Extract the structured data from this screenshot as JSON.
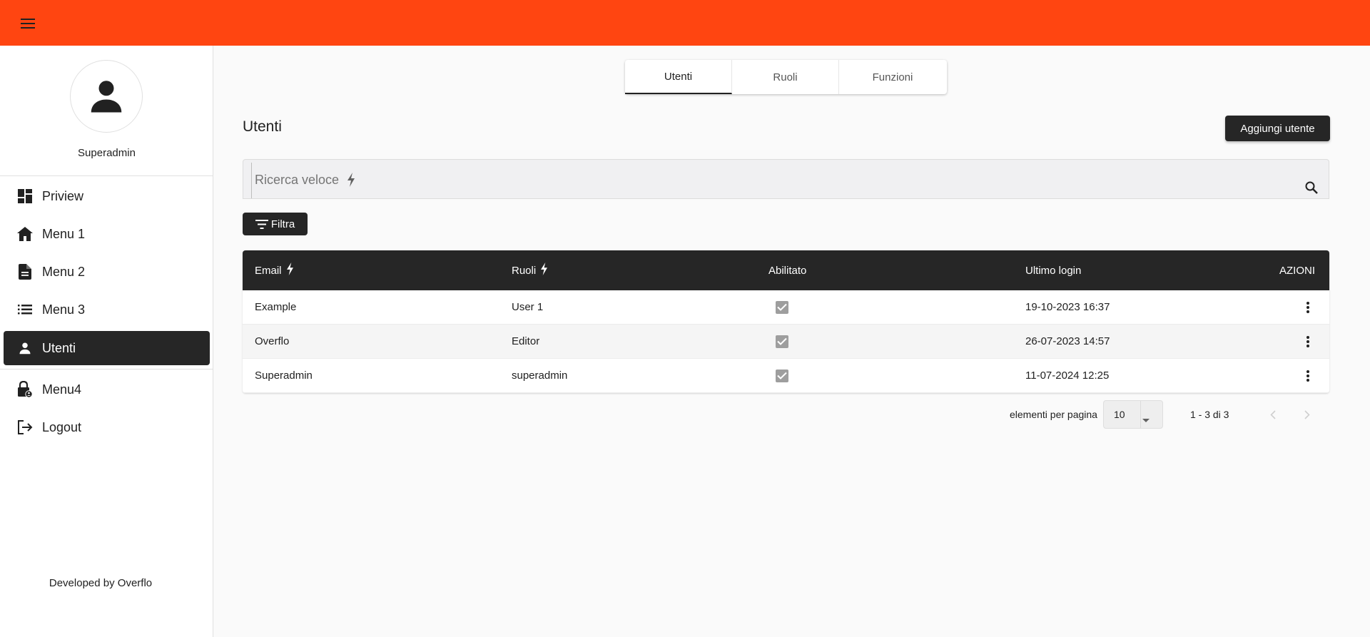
{
  "topbar": {
    "color": "#ff4511"
  },
  "sidebar": {
    "profile_name": "Superadmin",
    "items": [
      {
        "label": "Priview",
        "icon": "dashboard-icon",
        "active": false
      },
      {
        "label": "Menu 1",
        "icon": "home-icon",
        "active": false
      },
      {
        "label": "Menu 2",
        "icon": "document-icon",
        "active": false
      },
      {
        "label": "Menu 3",
        "icon": "list-icon",
        "active": false
      },
      {
        "label": "Utenti",
        "icon": "person-icon",
        "active": true
      },
      {
        "label": "Menu4",
        "icon": "lock-person-icon",
        "active": false
      },
      {
        "label": "Logout",
        "icon": "logout-icon",
        "active": false
      }
    ],
    "footer": "Developed by Overflo"
  },
  "tabs": [
    {
      "label": "Utenti",
      "active": true
    },
    {
      "label": "Ruoli",
      "active": false
    },
    {
      "label": "Funzioni",
      "active": false
    }
  ],
  "page": {
    "title": "Utenti",
    "add_button": "Aggiungi utente"
  },
  "search": {
    "placeholder": "Ricerca veloce"
  },
  "filter_button": "Filtra",
  "table": {
    "headers": [
      "Email",
      "Ruoli",
      "Abilitato",
      "Ultimo login",
      "AZIONI"
    ],
    "rows": [
      {
        "email": "Example",
        "role": "User 1",
        "enabled": true,
        "last_login": "19-10-2023 16:37"
      },
      {
        "email": "Overflo",
        "role": "Editor",
        "enabled": true,
        "last_login": "26-07-2023 14:57"
      },
      {
        "email": "Superadmin",
        "role": "superadmin",
        "enabled": true,
        "last_login": "11-07-2024 12:25"
      }
    ]
  },
  "paginator": {
    "per_page_label": "elementi per pagina",
    "per_page_value": "10",
    "range": "1 - 3 di 3"
  }
}
